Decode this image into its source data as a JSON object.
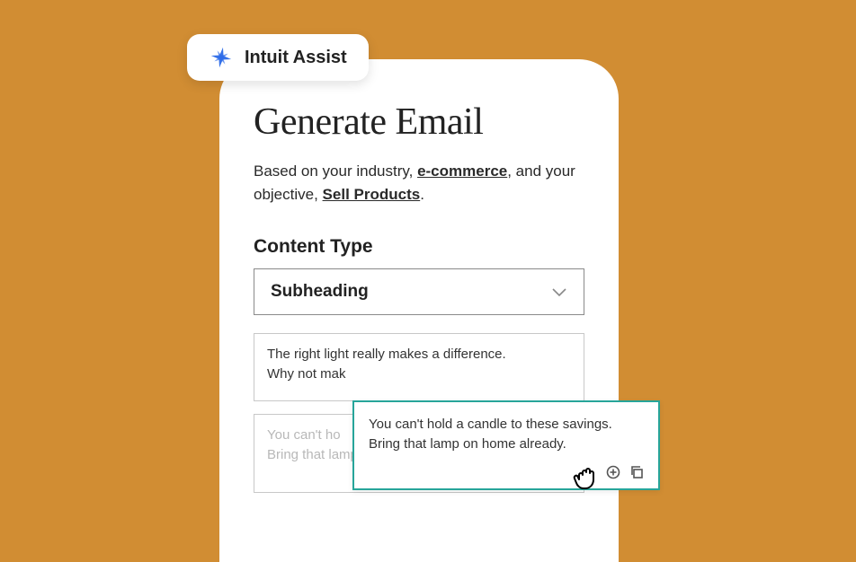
{
  "badge": {
    "label": "Intuit Assist"
  },
  "panel": {
    "title": "Generate Email",
    "context": {
      "prefix": "Based on your industry, ",
      "industry": "e-commerce",
      "mid": ", and your objective, ",
      "objective": "Sell Products",
      "suffix": "."
    },
    "section_title": "Content Type",
    "dropdown": {
      "selected": "Subheading"
    },
    "suggestions": [
      {
        "line1": "The right light really makes a difference.",
        "line2": "Why not mak"
      },
      {
        "line1": "You can't ho",
        "line2": "Bring that lamp on home already."
      }
    ]
  },
  "tooltip": {
    "line1": "You can't hold a candle to these savings.",
    "line2": "Bring that lamp on home already."
  }
}
